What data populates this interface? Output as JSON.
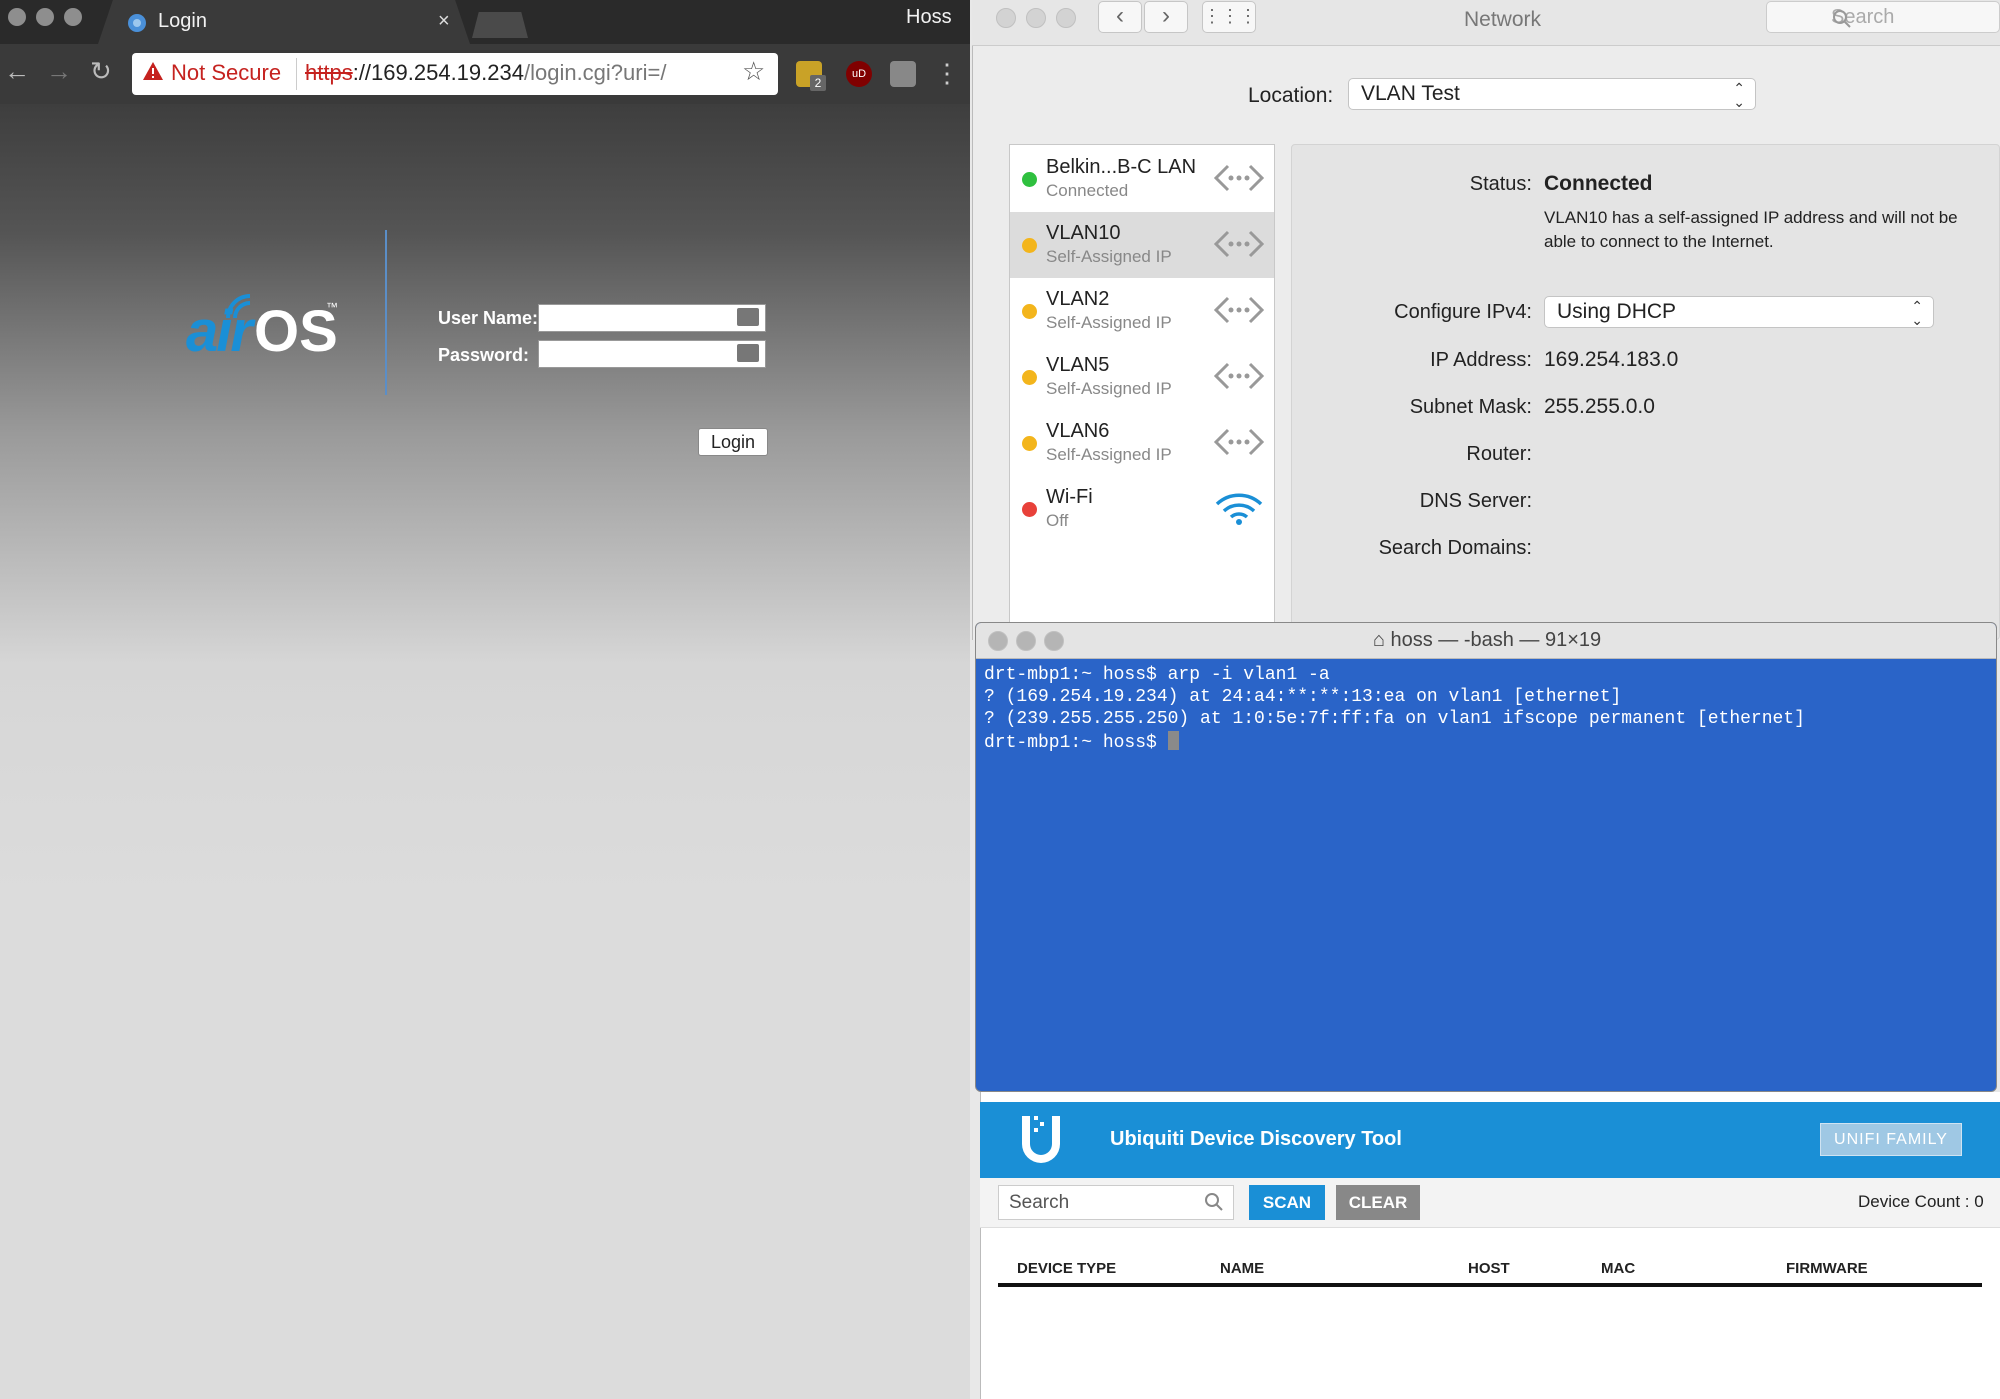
{
  "chrome": {
    "tab_title": "Login",
    "tab_close": "×",
    "profile_name": "Hoss",
    "not_secure": "Not Secure",
    "url_scheme": "https",
    "url_host": "://169.254.19.234",
    "url_path": "/login.cgi?uri=/",
    "ext_badge": "2",
    "ext_ublock": "uD"
  },
  "airos": {
    "logo_air": "air",
    "logo_os": "OS",
    "logo_tm": "™",
    "username_label": "User Name:",
    "password_label": "Password:",
    "login_button": "Login"
  },
  "network": {
    "title": "Network",
    "search_placeholder": "Search",
    "location_label": "Location:",
    "location_value": "VLAN Test",
    "services": [
      {
        "name": "Belkin...B-C LAN",
        "status": "Connected",
        "dot": "#2fc03f"
      },
      {
        "name": "VLAN10",
        "status": "Self-Assigned IP",
        "dot": "#f3b51c"
      },
      {
        "name": "VLAN2",
        "status": "Self-Assigned IP",
        "dot": "#f3b51c"
      },
      {
        "name": "VLAN5",
        "status": "Self-Assigned IP",
        "dot": "#f3b51c"
      },
      {
        "name": "VLAN6",
        "status": "Self-Assigned IP",
        "dot": "#f3b51c"
      },
      {
        "name": "Wi-Fi",
        "status": "Off",
        "dot": "#e8413a"
      }
    ],
    "status_label": "Status:",
    "status_value": "Connected",
    "status_desc": "VLAN10 has a self-assigned IP address and will not be able to connect to the Internet.",
    "configure_label": "Configure IPv4:",
    "configure_value": "Using DHCP",
    "ip_label": "IP Address:",
    "ip_value": "169.254.183.0",
    "subnet_label": "Subnet Mask:",
    "subnet_value": "255.255.0.0",
    "router_label": "Router:",
    "dns_label": "DNS Server:",
    "search_domains_label": "Search Domains:"
  },
  "terminal": {
    "title": "hoss — -bash — 91×19",
    "lines": [
      "drt-mbp1:~ hoss$ arp -i vlan1 -a",
      "? (169.254.19.234) at 24:a4:**:**:13:ea on vlan1 [ethernet]",
      "? (239.255.255.250) at 1:0:5e:7f:ff:fa on vlan1 ifscope permanent [ethernet]",
      "drt-mbp1:~ hoss$ "
    ]
  },
  "ubnt": {
    "title": "Ubiquiti Device Discovery Tool",
    "unifi_button": "UNIFI FAMILY",
    "search_placeholder": "Search",
    "scan_button": "SCAN",
    "clear_button": "CLEAR",
    "device_count": "Device Count : 0",
    "columns": [
      "DEVICE TYPE",
      "NAME",
      "HOST",
      "MAC",
      "FIRMWARE"
    ]
  }
}
